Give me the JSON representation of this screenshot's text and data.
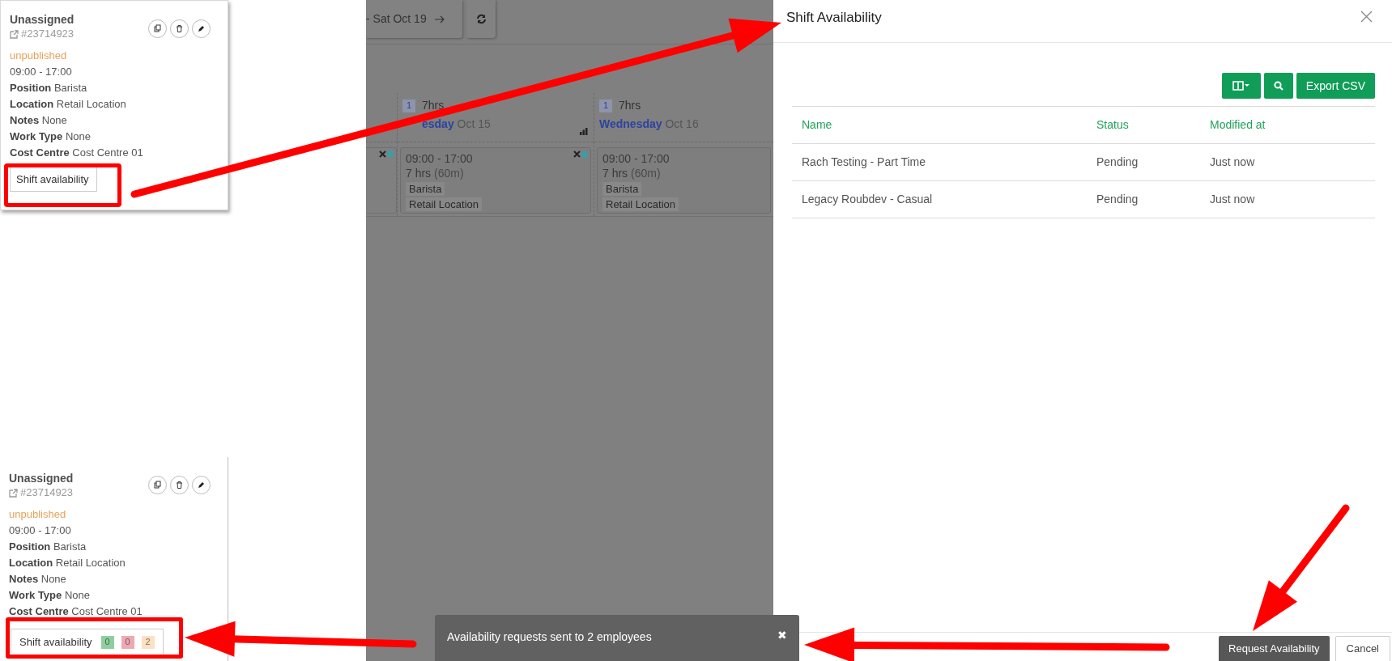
{
  "left_popups": [
    {
      "title": "Unassigned",
      "shift_id": "#23714923",
      "publish_status": "unpublished",
      "time": "09:00 - 17:00",
      "details": [
        {
          "label": "Position",
          "value": "Barista"
        },
        {
          "label": "Location",
          "value": "Retail Location"
        },
        {
          "label": "Notes",
          "value": "None"
        },
        {
          "label": "Work Type",
          "value": "None"
        },
        {
          "label": "Cost Centre",
          "value": "Cost Centre 01"
        }
      ],
      "button": {
        "label": "Shift availability"
      }
    },
    {
      "title": "Unassigned",
      "shift_id": "#23714923",
      "publish_status": "unpublished",
      "time": "09:00 - 17:00",
      "details": [
        {
          "label": "Position",
          "value": "Barista"
        },
        {
          "label": "Location",
          "value": "Retail Location"
        },
        {
          "label": "Notes",
          "value": "None"
        },
        {
          "label": "Work Type",
          "value": "None"
        },
        {
          "label": "Cost Centre",
          "value": "Cost Centre 01"
        }
      ],
      "button": {
        "label": "Shift availability",
        "counts": [
          {
            "value": "0",
            "color": "#8fcf9f"
          },
          {
            "value": "0",
            "color": "#eeaab3"
          },
          {
            "value": "2",
            "color": "#fbe1c2"
          }
        ]
      }
    }
  ],
  "scheduler": {
    "date_range": "- Sat Oct 19",
    "days": [
      {
        "count": "1",
        "hours": "7hrs",
        "weekday": "esday",
        "date": "Oct 15",
        "shift": {
          "time": "09:00 - 17:00",
          "duration": "7 hrs",
          "break": "(60m)",
          "tags": [
            "Barista",
            "Retail Location"
          ]
        }
      },
      {
        "count": "1",
        "hours": "7hrs",
        "weekday": "Wednesday",
        "date": "Oct 16",
        "shift": {
          "time": "09:00 - 17:00",
          "duration": "7 hrs",
          "break": "(60m)",
          "tags": [
            "Barista",
            "Retail Location"
          ]
        }
      }
    ]
  },
  "panel": {
    "title": "Shift Availability",
    "export_label": "Export CSV",
    "table": {
      "columns": [
        "Name",
        "Status",
        "Modified at"
      ],
      "rows": [
        [
          "Rach Testing - Part Time",
          "Pending",
          "Just now"
        ],
        [
          "Legacy Roubdev - Casual",
          "Pending",
          "Just now"
        ]
      ]
    },
    "footer_buttons": [
      {
        "label": "Request Availability",
        "kind": "primary"
      },
      {
        "label": "Cancel",
        "kind": "secondary"
      }
    ]
  },
  "toast": {
    "message": "Availability requests sent to 2 employees",
    "close": "✖"
  }
}
